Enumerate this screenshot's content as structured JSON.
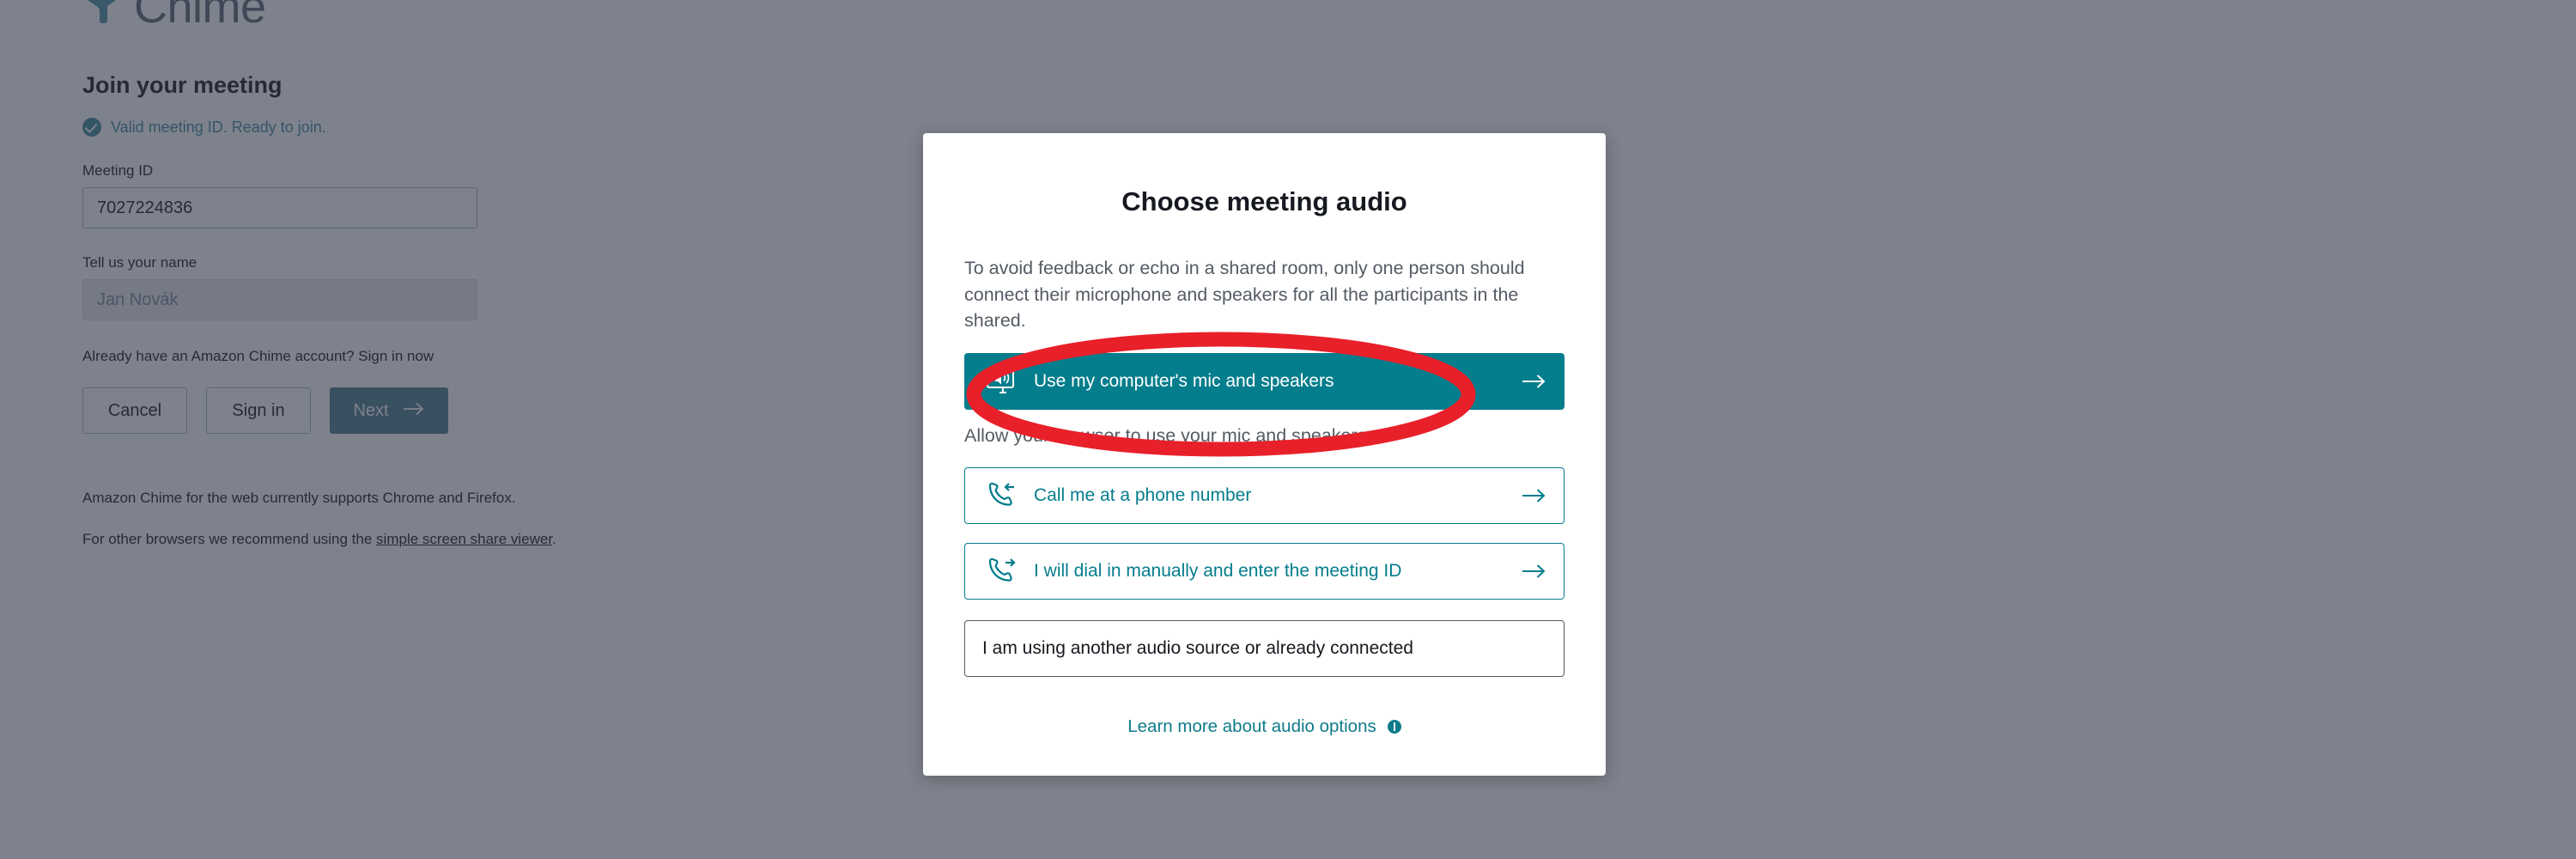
{
  "background": {
    "brand": "Chime",
    "logo_icon": "chime-logo-icon",
    "heading": "Join your meeting",
    "valid_status": "Valid meeting ID. Ready to join.",
    "valid_icon": "check-circle-icon",
    "meeting_id_label": "Meeting ID",
    "meeting_id_value": "7027224836",
    "name_label": "Tell us your name",
    "name_placeholder": "Jan Novák",
    "signin_prompt": "Already have an Amazon Chime account? Sign in now",
    "buttons": {
      "cancel": "Cancel",
      "sign_in": "Sign in",
      "next": "Next",
      "next_arrow_icon": "arrow-right-icon"
    },
    "footer_line1": "Amazon Chime for the web currently supports Chrome and Firefox.",
    "footer_line2_prefix": "For other browsers we recommend using the ",
    "footer_link": "simple screen share viewer",
    "footer_line2_suffix": "."
  },
  "modal": {
    "title": "Choose meeting audio",
    "body_text": "To avoid feedback or echo in a shared room, only one person should connect their microphone and speakers for all the participants in the shared.",
    "options": [
      {
        "id": "computer-audio",
        "label": "Use my computer's mic and speakers",
        "icon": "monitor-speaker-icon",
        "arrow_icon": "arrow-right-icon",
        "style": "teal",
        "highlighted": true
      },
      {
        "id": "call-me",
        "label": "Call me at a phone number",
        "icon": "phone-incoming-icon",
        "arrow_icon": "arrow-right-icon",
        "style": "outline",
        "highlighted": false
      },
      {
        "id": "dial-in",
        "label": "I will dial in manually and enter the meeting ID",
        "icon": "phone-outgoing-icon",
        "arrow_icon": "arrow-right-icon",
        "style": "outline",
        "highlighted": false
      },
      {
        "id": "other-audio",
        "label": "I am using another audio source or already connected",
        "icon": "none",
        "arrow_icon": "none",
        "style": "plain",
        "highlighted": false
      }
    ],
    "allow_text": "Allow your browser to use your mic and speakers",
    "learn_more": "Learn more about audio options",
    "learn_more_icon": "info-icon"
  },
  "annotation": {
    "shape": "ellipse",
    "color": "#e8202a",
    "target": "Use my computer's mic and speakers"
  },
  "colors": {
    "teal": "#047d8c",
    "annotation_red": "#e8202a",
    "overlay": "#2f3646",
    "body_text": "#545b64"
  }
}
